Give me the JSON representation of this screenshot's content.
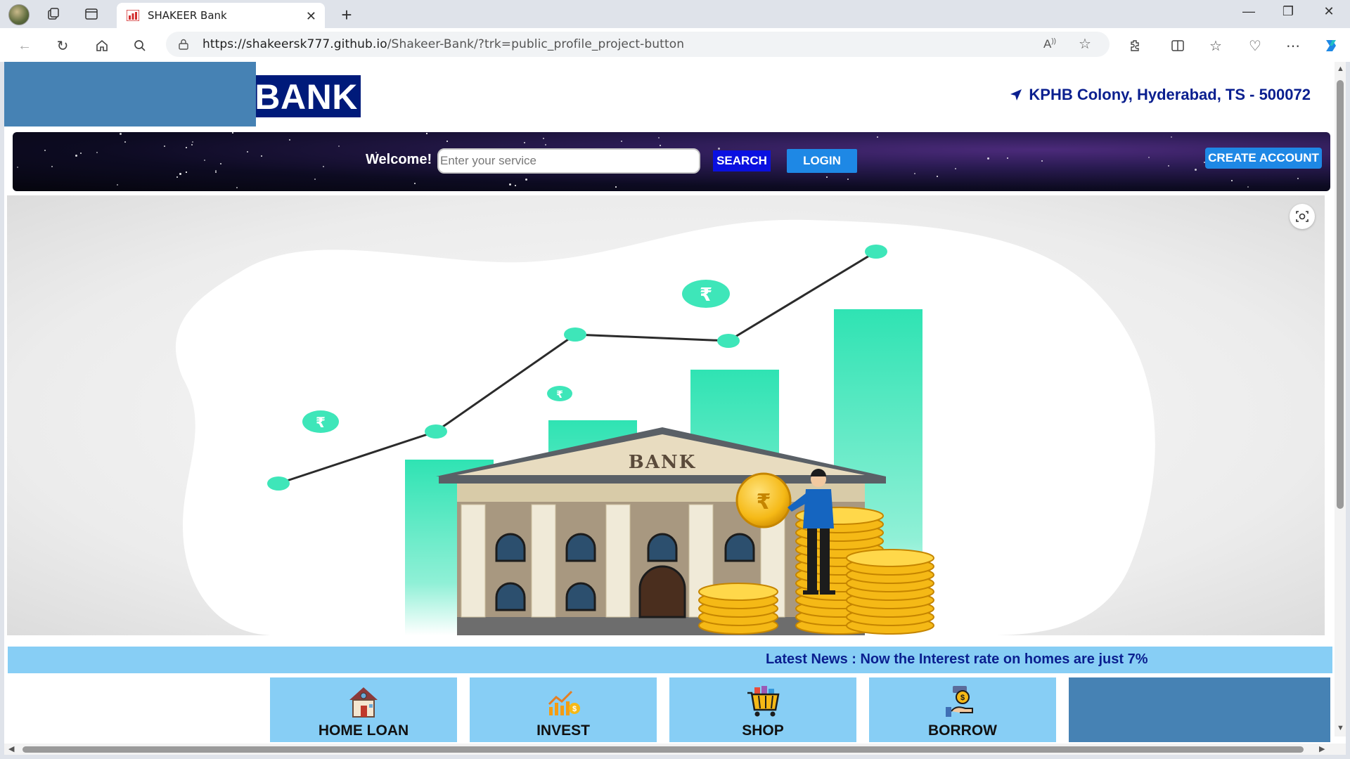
{
  "browser": {
    "tab_title": "SHAKEER Bank",
    "url_domain": "https://shakeersk777.github.io",
    "url_path": "/Shakeer-Bank/?trk=public_profile_project-button"
  },
  "header": {
    "logo_text": "SHAKEER BANK",
    "location": "KPHB Colony, Hyderabad, TS - 500072"
  },
  "searchbar": {
    "welcome": "Welcome!",
    "placeholder": "Enter your service",
    "search_label": "SEARCH",
    "login_label": "LOGIN",
    "create_account_label": "CREATE ACCOUNT"
  },
  "hero": {
    "bank_sign": "BANK",
    "currency_symbol": "₹"
  },
  "news": {
    "text": "Latest News : Now the Interest rate on homes are just 7%"
  },
  "services": [
    {
      "label": "HOME LOAN",
      "icon": "house-icon"
    },
    {
      "label": "INVEST",
      "icon": "growth-chart-icon"
    },
    {
      "label": "SHOP",
      "icon": "shopping-cart-icon"
    },
    {
      "label": "BORROW",
      "icon": "money-hand-icon"
    }
  ],
  "colors": {
    "brand_navy": "#001a7a",
    "accent_blue": "#1e88e5",
    "search_blue": "#0a10e0",
    "service_light": "#87cef5",
    "service_dark": "#4682b4",
    "chart_teal": "#3ee6b9"
  }
}
